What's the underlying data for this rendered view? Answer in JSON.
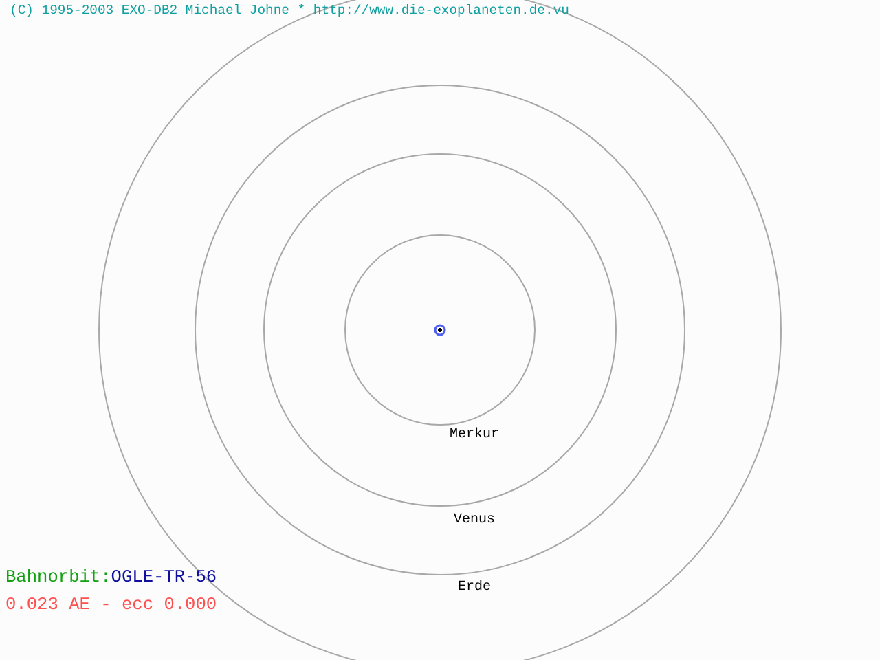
{
  "copyright": "(C) 1995-2003 EXO-DB2 Michael Johne * http://www.die-exoplaneten.de.vu",
  "orbits": [
    {
      "name": "Merkur"
    },
    {
      "name": "Venus"
    },
    {
      "name": "Erde"
    }
  ],
  "orbit_label": "Bahnorbit:",
  "planet": "OGLE-TR-56",
  "orbit_info": "0.023 AE - ecc 0.000"
}
